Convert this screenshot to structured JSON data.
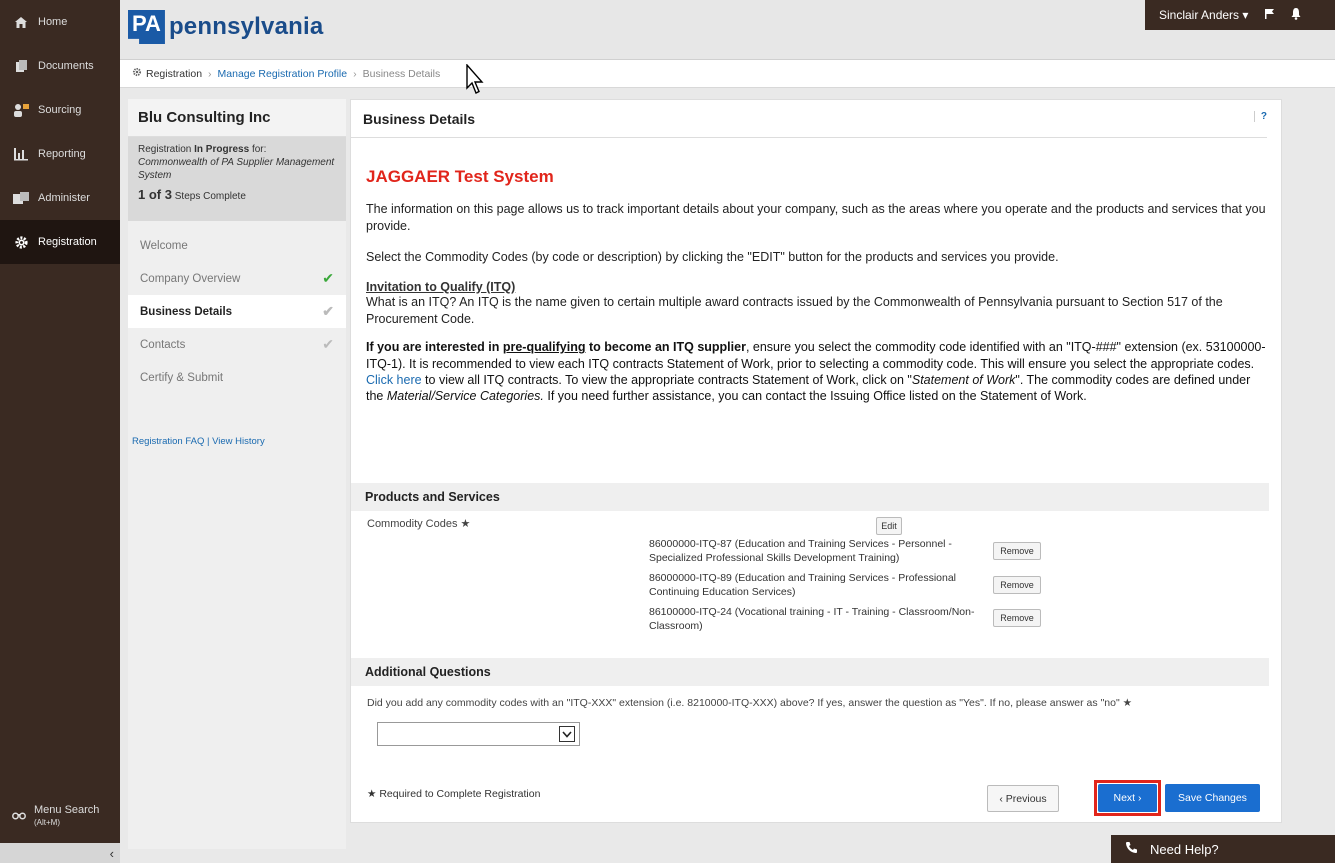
{
  "nav": {
    "items": [
      {
        "label": "Home",
        "icon": "home-icon"
      },
      {
        "label": "Documents",
        "icon": "documents-icon"
      },
      {
        "label": "Sourcing",
        "icon": "sourcing-icon"
      },
      {
        "label": "Reporting",
        "icon": "reporting-icon"
      },
      {
        "label": "Administer",
        "icon": "administer-icon"
      },
      {
        "label": "Registration",
        "icon": "gear-icon",
        "active": true
      }
    ],
    "menu_search": "Menu Search",
    "menu_search_shortcut": "(Alt+M)"
  },
  "header": {
    "logo_pa": "PA",
    "logo_word": "pennsylvania",
    "user": "Sinclair Anders",
    "colors": {
      "brand_dark": "#3a2a22",
      "accent_blue": "#1a6ed0",
      "alert_red": "#e1251b"
    }
  },
  "breadcrumb": {
    "root": "Registration",
    "middle": "Manage Registration Profile",
    "current": "Business Details"
  },
  "steps": {
    "company": "Blu Consulting Inc",
    "progress_prefix": "Registration ",
    "progress_status": "In Progress",
    "progress_suffix": " for:",
    "system_name": "Commonwealth of PA Supplier Management System",
    "count": "1 of 3",
    "count_suffix": " Steps Complete",
    "items": [
      {
        "label": "Welcome",
        "state": "none"
      },
      {
        "label": "Company Overview",
        "state": "done"
      },
      {
        "label": "Business Details",
        "state": "pending",
        "active": true
      },
      {
        "label": "Contacts",
        "state": "pending"
      },
      {
        "label": "Certify & Submit",
        "state": "none"
      }
    ],
    "faq_link": "Registration FAQ",
    "divider": " | ",
    "history_link": "View History"
  },
  "main": {
    "title": "Business Details",
    "help": "?",
    "system_title": "JAGGAER Test System",
    "intro": "The information on this page allows us to track important details about your company, such as the areas where you operate and the products and services that you provide.",
    "select_text": "Select the Commodity Codes (by code or description) by clicking the \"EDIT\" button for the products and services you provide.",
    "itq_heading": "Invitation to Qualify (ITQ)",
    "itq_text": "What is an ITQ? An ITQ is the name given to certain multiple award contracts issued by the Commonwealth of Pennsylvania pursuant to Section 517 of the Procurement Code.",
    "itq_bold_1": "If you are interested in ",
    "itq_bold_u": "pre-qualifying",
    "itq_bold_2": " to become an ITQ supplier",
    "itq_rest_1": ", ensure you select the commodity code identified with an \"ITQ-###\" extension (ex. 53100000-ITQ-1). It is recommended to view each ITQ contracts Statement of Work, prior to selecting a commodity code. This will ensure you select the appropriate codes. ",
    "itq_link": "Click here",
    "itq_rest_2": " to view all ITQ contracts. To view the appropriate contracts Statement of Work, click on \"",
    "itq_italic_1": "Statement of Work",
    "itq_rest_3": "\". The commodity codes are defined under the ",
    "itq_italic_2": "Material/Service Categories.",
    "itq_rest_4": " If you need further assistance, you can contact the Issuing Office listed on the Statement of Work."
  },
  "products": {
    "heading": "Products and Services",
    "label": "Commodity Codes",
    "required_star": "★",
    "edit_label": "Edit",
    "remove_label": "Remove",
    "codes": [
      "86000000-ITQ-87 (Education and Training Services - Personnel - Specialized Professional Skills Development Training)",
      "86000000-ITQ-89 (Education and Training Services - Professional Continuing Education Services)",
      "86100000-ITQ-24 (Vocational training - IT - Training - Classroom/Non-Classroom)"
    ]
  },
  "questions": {
    "heading": "Additional Questions",
    "question": "Did you add any commodity codes with an \"ITQ-XXX\" extension (i.e. 8210000-ITQ-XXX) above? If yes, answer the question as \"Yes\". If no, please answer as \"no\"",
    "required_star": "★",
    "selected_value": ""
  },
  "footer": {
    "required_note": "Required to Complete Registration",
    "required_star": "★",
    "previous": "‹ Previous",
    "next": "Next ›",
    "save": "Save Changes",
    "need_help": "Need Help?"
  }
}
